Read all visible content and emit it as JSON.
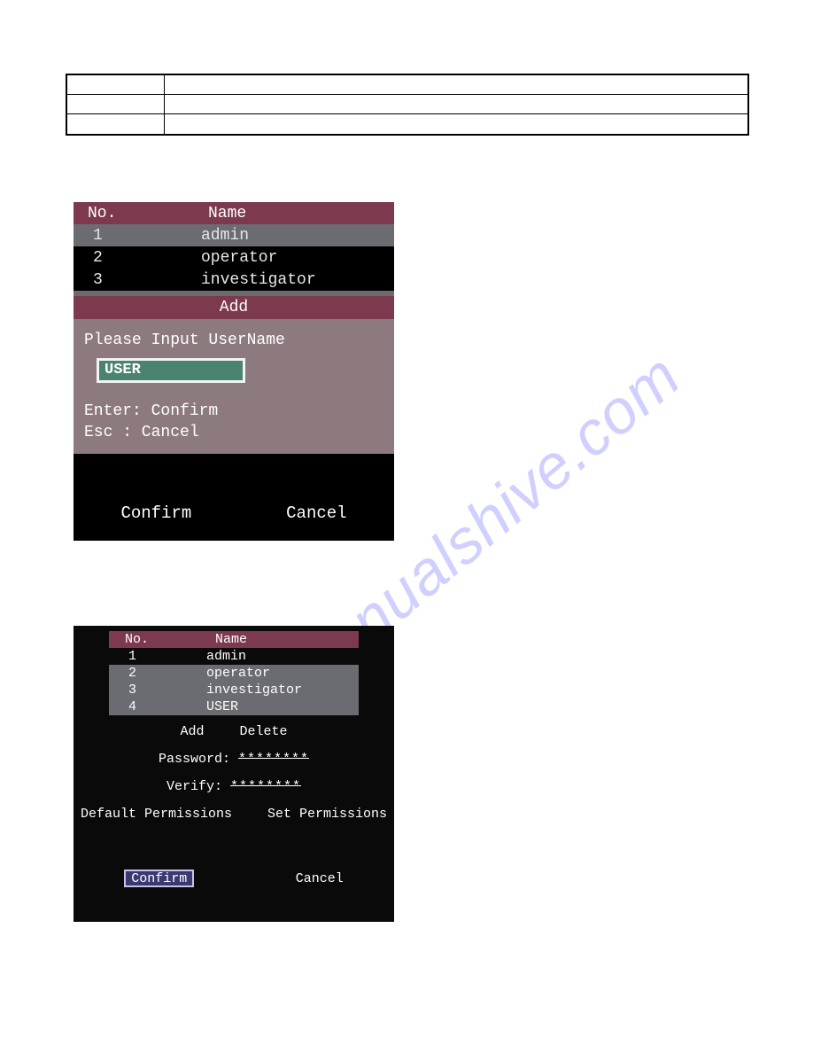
{
  "watermark": "manualshive.com",
  "screenshot1": {
    "header": {
      "no": "No.",
      "name": "Name"
    },
    "rows": [
      {
        "no": "1",
        "name": "admin"
      },
      {
        "no": "2",
        "name": "operator"
      },
      {
        "no": "3",
        "name": "investigator"
      }
    ],
    "add_title": "Add",
    "prompt": "Please Input UserName",
    "input_value": "USER",
    "hint_enter": "Enter: Confirm",
    "hint_esc": "Esc  : Cancel",
    "confirm": "Confirm",
    "cancel": "Cancel"
  },
  "screenshot2": {
    "header": {
      "no": "No.",
      "name": "Name"
    },
    "rows": [
      {
        "no": "1",
        "name": "admin"
      },
      {
        "no": "2",
        "name": "operator"
      },
      {
        "no": "3",
        "name": "investigator"
      },
      {
        "no": "4",
        "name": "USER"
      }
    ],
    "add": "Add",
    "delete": "Delete",
    "password_label": "Password:",
    "password_value": "********",
    "verify_label": "Verify:",
    "verify_value": "********",
    "default_perm": "Default Permissions",
    "set_perm": "Set Permissions",
    "confirm": "Confirm",
    "cancel": "Cancel"
  }
}
